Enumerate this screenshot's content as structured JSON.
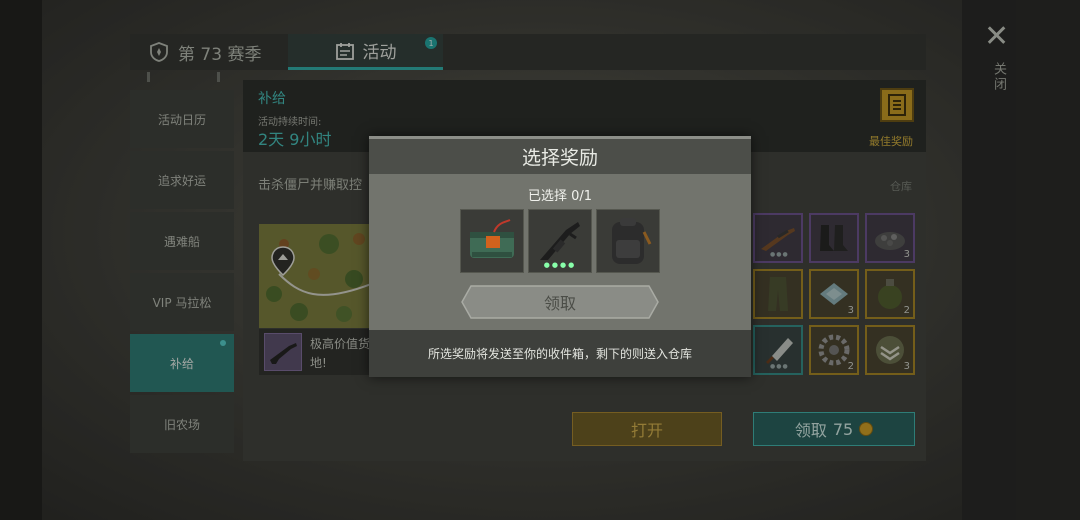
{
  "tabs": {
    "season": "第 73 赛季",
    "activity": "活动",
    "activity_badge": "1"
  },
  "sidebar": {
    "items": [
      {
        "label": "活动日历"
      },
      {
        "label": "追求好运"
      },
      {
        "label": "遇难船"
      },
      {
        "label": "VIP 马拉松"
      },
      {
        "label": "补给"
      },
      {
        "label": "旧农场"
      }
    ],
    "active_index": 4
  },
  "event": {
    "title": "补给",
    "duration_label": "活动持续时间:",
    "duration": "2天 9小时",
    "best_reward": "最佳奖励",
    "description": "击杀僵尸并赚取控",
    "storage": "仓库",
    "reward_text_1": "极高价值货",
    "reward_text_2": "地!"
  },
  "buttons": {
    "open": "打开",
    "claim": "领取",
    "claim_cost": "75"
  },
  "grid": {
    "cells": [
      {
        "icon": "rifle-icon",
        "count": "",
        "tier": "purple"
      },
      {
        "icon": "boots-icon",
        "count": "",
        "tier": "purple"
      },
      {
        "icon": "gravel-icon",
        "count": "3",
        "tier": "purple"
      },
      {
        "icon": "pants-icon",
        "count": "",
        "tier": "gold"
      },
      {
        "icon": "cloth-icon",
        "count": "3",
        "tier": "gold"
      },
      {
        "icon": "grenade-icon",
        "count": "2",
        "tier": "gold"
      },
      {
        "icon": "cleaver-icon",
        "count": "",
        "tier": "teal"
      },
      {
        "icon": "gear-icon",
        "count": "2",
        "tier": "gold"
      },
      {
        "icon": "badge-icon",
        "count": "3",
        "tier": "gold"
      }
    ]
  },
  "close": {
    "label": "关闭"
  },
  "modal": {
    "title": "选择奖励",
    "selected": "已选择 0/1",
    "options": [
      {
        "icon": "explosive-crate-icon"
      },
      {
        "icon": "assault-rifle-icon"
      },
      {
        "icon": "backpack-icon"
      }
    ],
    "get_label": "领取",
    "footer": "所选奖励将发送至你的收件箱，剩下的则送入仓库"
  },
  "colors": {
    "accent_teal": "#2bb1ad",
    "gold": "#c99c1f",
    "panel_dark": "#262826"
  }
}
